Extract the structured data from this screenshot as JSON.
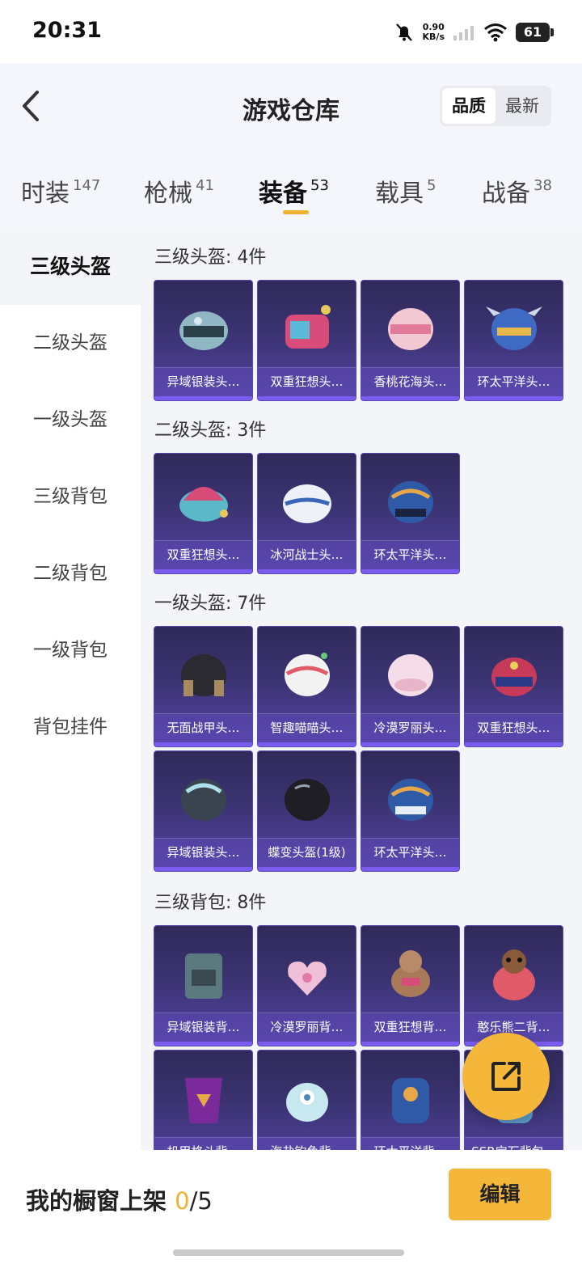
{
  "status_bar": {
    "time": "20:31",
    "net_speed": "0.90",
    "net_unit": "KB/s",
    "battery": "61"
  },
  "header": {
    "title": "游戏仓库",
    "sort_options": [
      "品质",
      "最新"
    ],
    "sort_selected": "品质"
  },
  "tabs": [
    {
      "label": "时装",
      "count": "147"
    },
    {
      "label": "枪械",
      "count": "41"
    },
    {
      "label": "装备",
      "count": "53",
      "active": true
    },
    {
      "label": "载具",
      "count": "5"
    },
    {
      "label": "战备",
      "count": "38"
    }
  ],
  "sidebar": [
    "三级头盔",
    "二级头盔",
    "一级头盔",
    "三级背包",
    "二级背包",
    "一级背包",
    "背包挂件"
  ],
  "sections": [
    {
      "title": "三级头盔: 4件",
      "items": [
        "异域银装头…",
        "双重狂想头…",
        "香桃花海头…",
        "环太平洋头…"
      ]
    },
    {
      "title": "二级头盔: 3件",
      "items": [
        "双重狂想头…",
        "冰河战士头…",
        "环太平洋头…"
      ]
    },
    {
      "title": "一级头盔: 7件",
      "items": [
        "无面战甲头…",
        "智趣喵喵头…",
        "冷漠罗丽头…",
        "双重狂想头…",
        "异域银装头…",
        "蝶变头盔(1级)",
        "环太平洋头…"
      ]
    },
    {
      "title": "三级背包: 8件",
      "items": [
        "异域银装背…",
        "冷漠罗丽背…",
        "双重狂想背…",
        "憨乐熊二背…",
        "机甲格斗背…",
        "海盐钓鱼背…",
        "环太平洋背…",
        "SSR宝石背包…"
      ]
    }
  ],
  "bottom": {
    "shelf_label": "我的橱窗上架",
    "shelf_count": "0",
    "shelf_total": "/5",
    "edit_label": "编辑"
  },
  "colors": {
    "accent": "#f5b73a",
    "card_bg": "#3b3372",
    "card_border": "#7a5cf0"
  }
}
